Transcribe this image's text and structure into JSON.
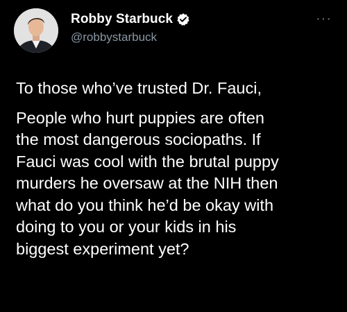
{
  "author": {
    "display_name": "Robby Starbuck",
    "handle": "@robbystarbuck",
    "verified": true,
    "avatar": "profile-photo"
  },
  "more_menu": {
    "label": "···",
    "icon": "more-options-icon"
  },
  "tweet": {
    "line1": "To those who’ve trusted Dr. Fauci,",
    "body": "People who hurt puppies are often\nthe most dangerous sociopaths. If\nFauci was cool with the brutal puppy\nmurders he oversaw at the NIH then\nwhat do you think he’d be okay with\ndoing to you or your kids in his\nbiggest experiment yet?"
  },
  "colors": {
    "background": "#000000",
    "text": "#ffffff",
    "secondary": "#8b98a5",
    "verified_badge": "#ffffff"
  }
}
